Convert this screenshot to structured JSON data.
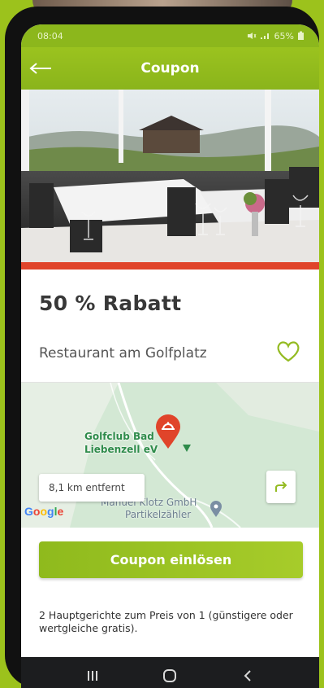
{
  "statusbar": {
    "time": "08:04",
    "battery": "65%"
  },
  "appbar": {
    "title": "Coupon",
    "back_icon": "arrow-left-icon"
  },
  "offer": {
    "title": "50 % Rabatt",
    "merchant": "Restaurant am Golfplatz",
    "favorite_icon": "heart-outline-icon"
  },
  "map": {
    "golf_label_line1": "Golfclub Bad",
    "golf_label_line2": "Liebenzell eV",
    "poi_label_line1": "Manuel Klotz GmbH",
    "poi_label_line2": "Partikelzähler",
    "distance": "8,1 km entfernt",
    "provider": "Google",
    "route_icon": "directions-arrow-icon"
  },
  "actions": {
    "redeem_label": "Coupon einlösen"
  },
  "description": "2 Hauptgerichte zum Preis von 1 (günstigere oder wertgleiche gratis).",
  "colors": {
    "brand_green": "#8cb71c",
    "accent_red": "#e0442a"
  }
}
